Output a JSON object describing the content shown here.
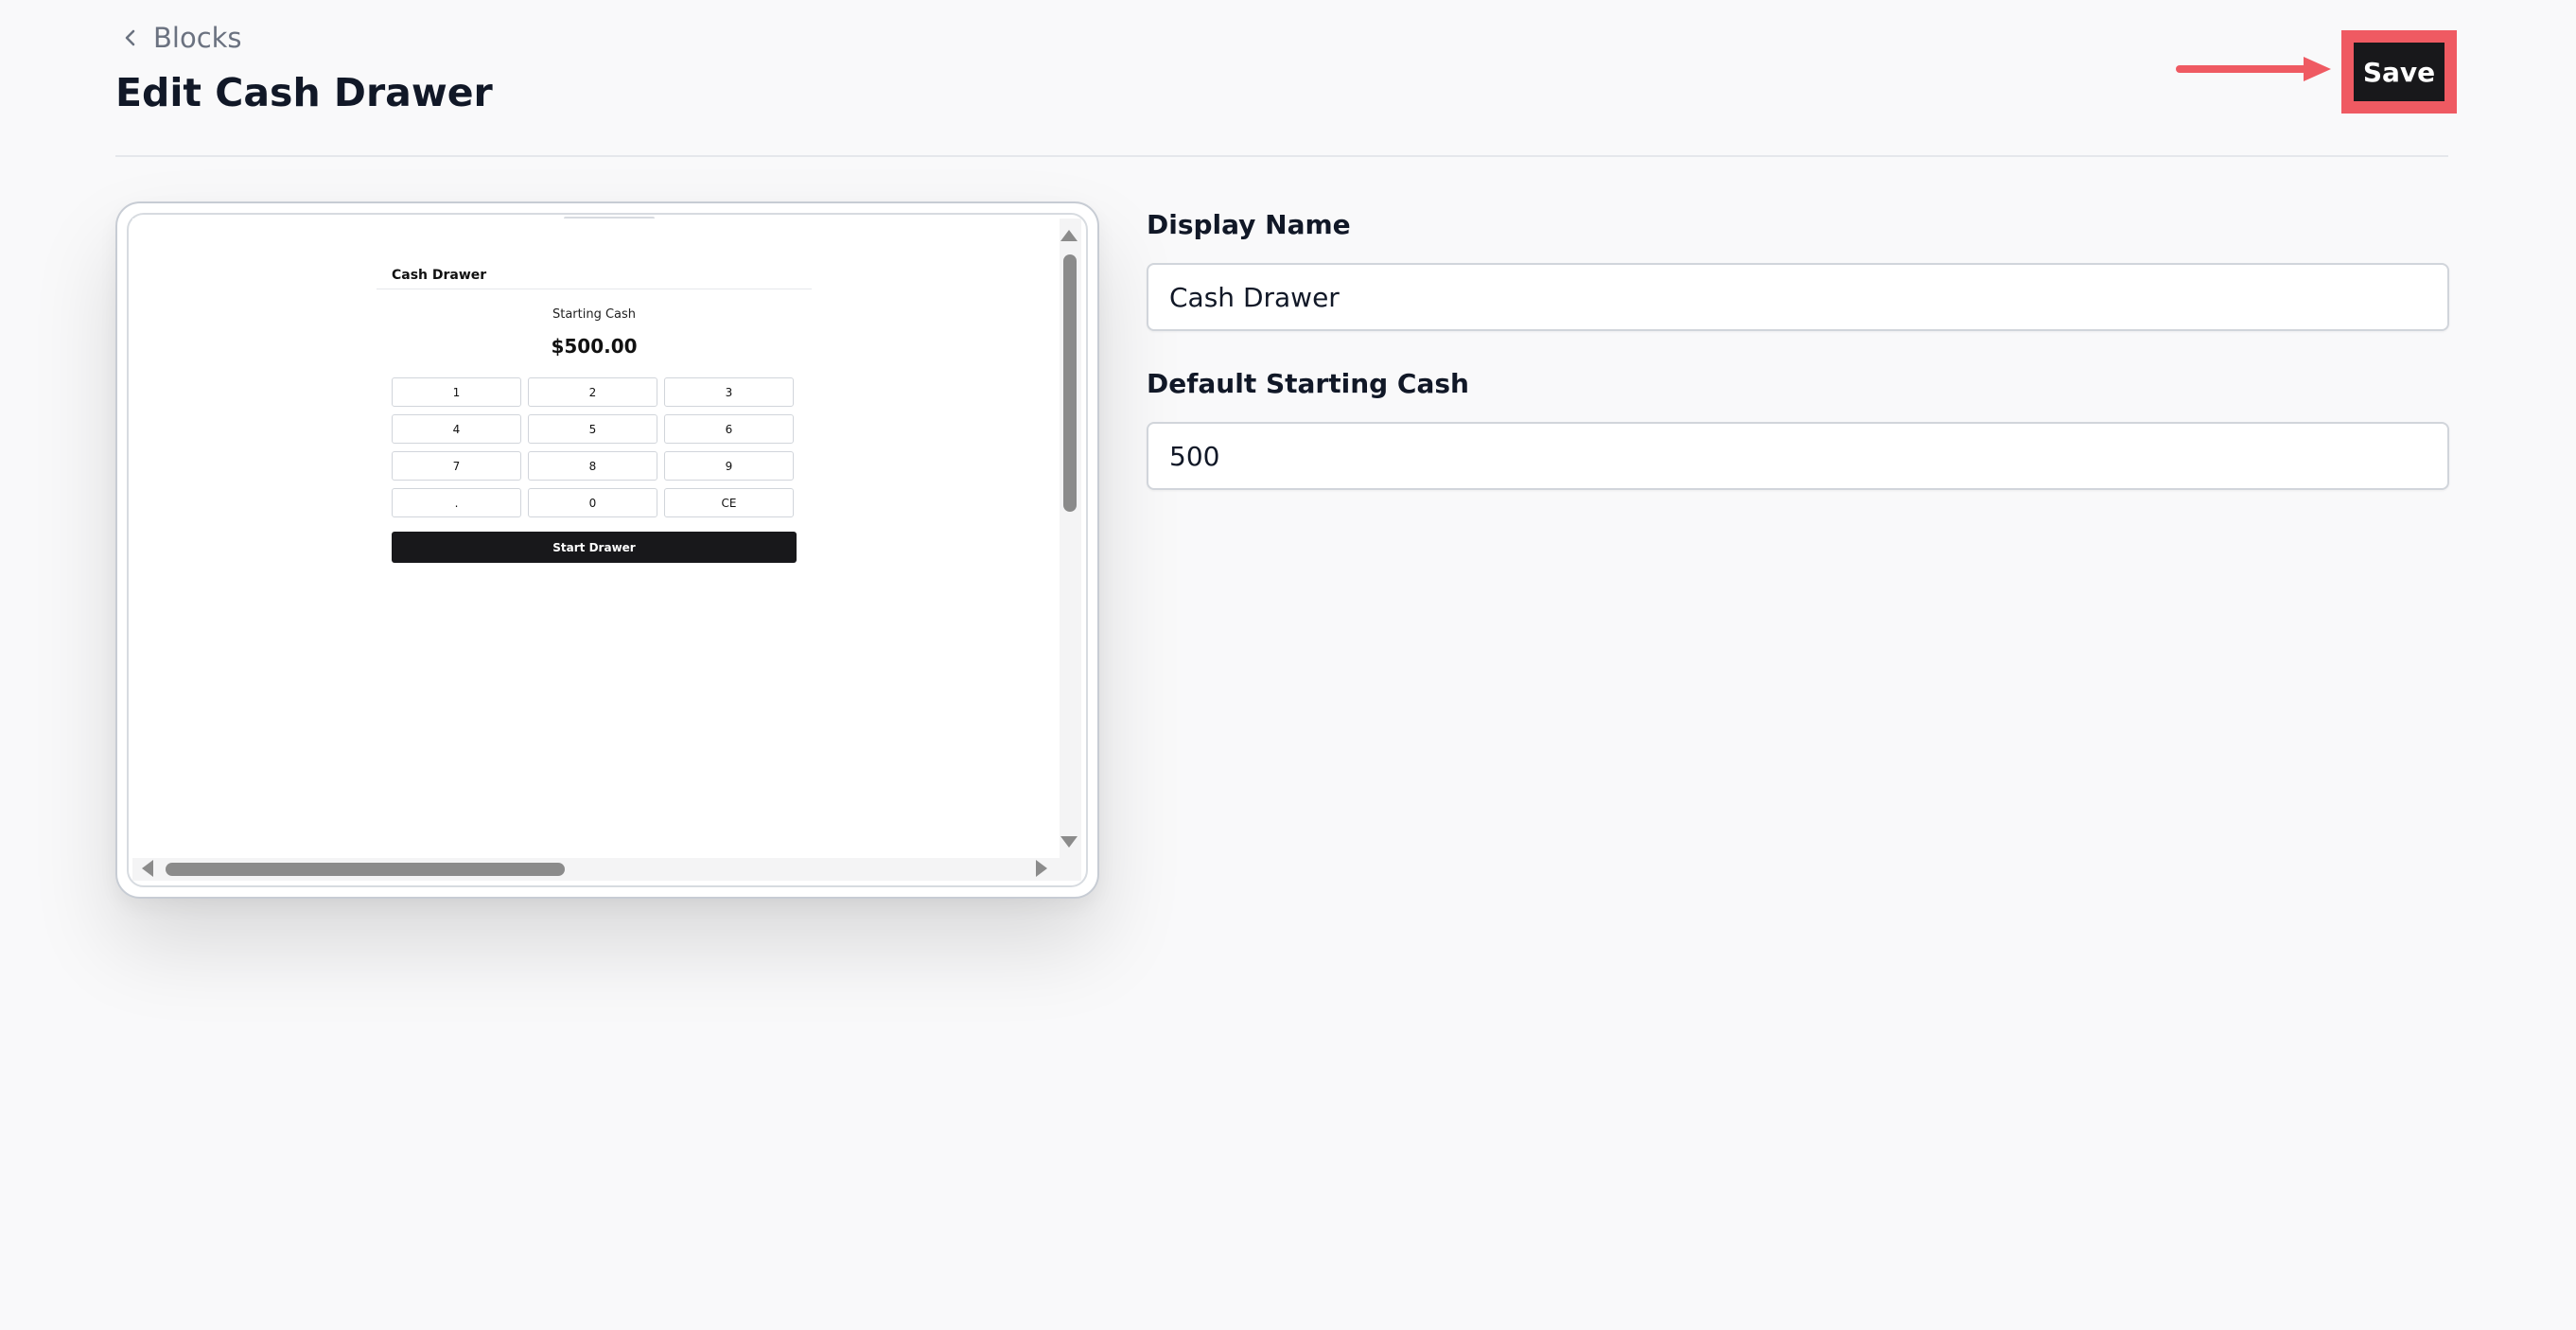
{
  "header": {
    "back_label": "Blocks",
    "title": "Edit Cash Drawer",
    "save_label": "Save"
  },
  "annotation": {
    "highlight_color": "#ef5a62",
    "arrow_target": "save-button"
  },
  "preview": {
    "title": "Cash Drawer",
    "starting_label": "Starting Cash",
    "amount": "$500.00",
    "keys": [
      "1",
      "2",
      "3",
      "4",
      "5",
      "6",
      "7",
      "8",
      "9",
      ".",
      "0",
      "CE"
    ],
    "start_button": "Start Drawer"
  },
  "form": {
    "display_name": {
      "label": "Display Name",
      "value": "Cash Drawer"
    },
    "default_starting_cash": {
      "label": "Default Starting Cash",
      "value": "500"
    }
  },
  "colors": {
    "background": "#f9f9fa",
    "primary_button": "#18181b",
    "annotation": "#ef5a62"
  }
}
